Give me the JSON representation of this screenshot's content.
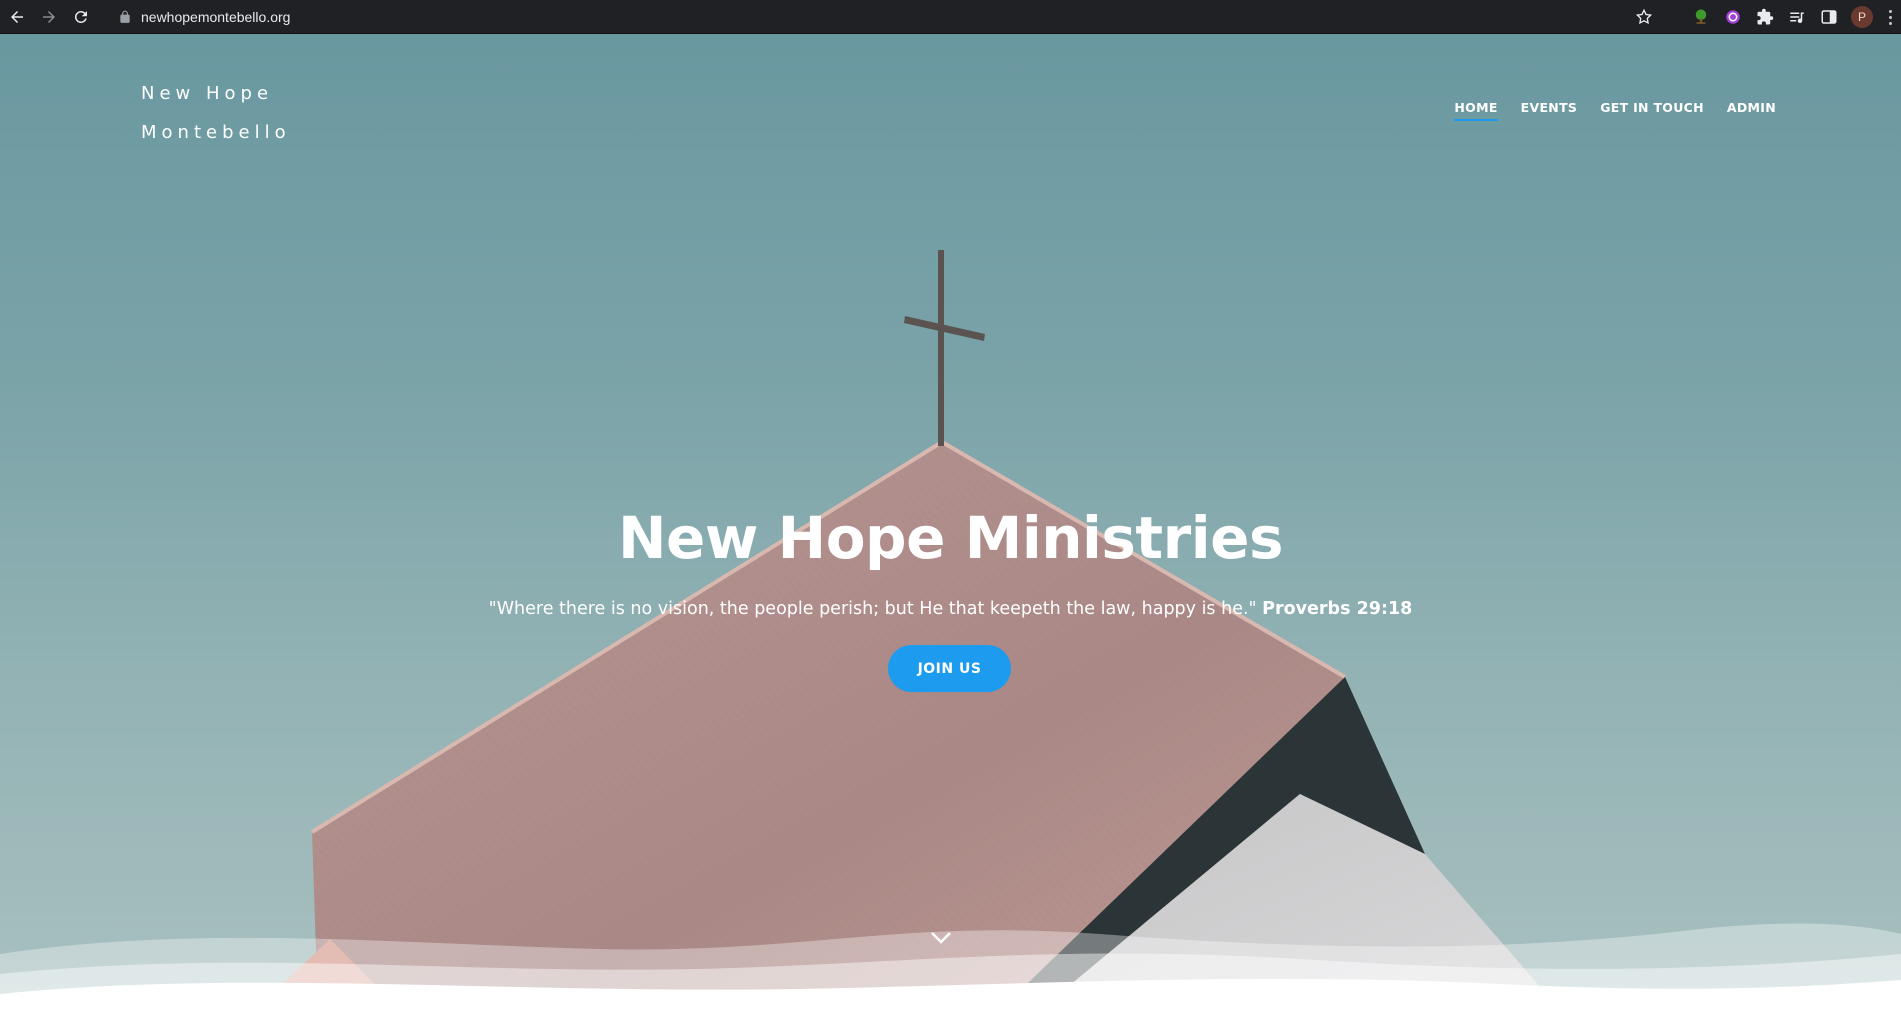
{
  "browser": {
    "url": "newhopemontebello.org",
    "profile_initial": "P",
    "icons": [
      "back-arrow-icon",
      "forward-arrow-icon",
      "reload-icon",
      "lock-icon",
      "bookmark-star-icon",
      "tree-extension-icon",
      "purple-extension-icon",
      "puzzle-extensions-icon",
      "reading-list-icon",
      "side-panel-icon",
      "menu-kebab-icon"
    ]
  },
  "site": {
    "brand_line1": "New Hope",
    "brand_line2": "Montebello",
    "nav": {
      "home": "HOME",
      "events": "EVENTS",
      "contact": "GET IN TOUCH",
      "admin": "ADMIN"
    },
    "active_nav": "HOME"
  },
  "hero": {
    "title": "New Hope Ministries",
    "verse_text": "\"Where there is no vision, the people perish; but He that keepeth the law, happy is he.\"",
    "verse_ref": "Proverbs 29:18",
    "cta_label": "JOIN US"
  },
  "colors": {
    "accent": "#1c9bef",
    "chrome_bg": "#202124",
    "sky": "#6a98a0",
    "roof": "#b08f8c"
  }
}
